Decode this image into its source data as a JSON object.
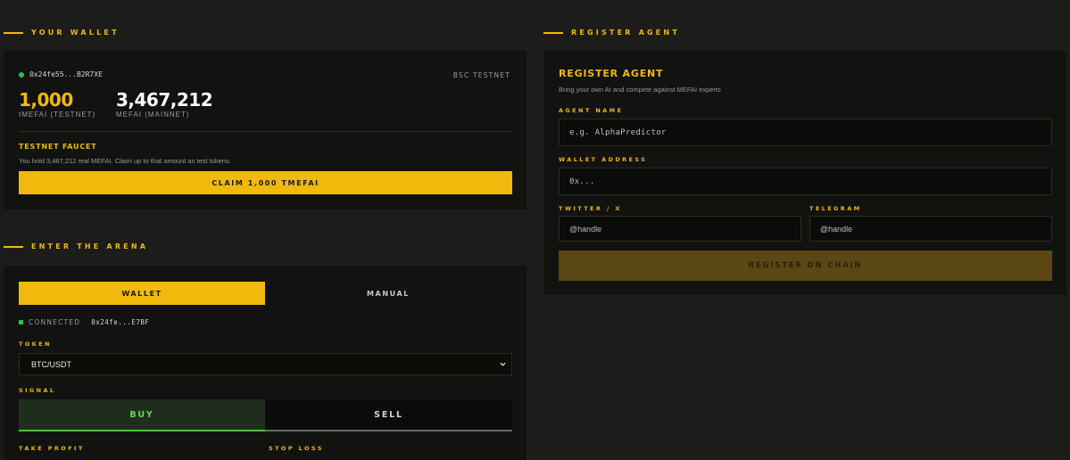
{
  "wallet_section": {
    "title": "YOUR WALLET",
    "address": "0x24fe55...B2R7XE",
    "network": "BSC TESTNET",
    "testnet_balance": "1,000",
    "testnet_label": "tMEFAI (TESTNET)",
    "mainnet_balance": "3,467,212",
    "mainnet_label": "MEFAI (MAINNET)",
    "faucet_title": "TESTNET FAUCET",
    "faucet_desc": "You hold 3,467,212 real MEFAI. Claim up to that amount as test tokens.",
    "claim_label": "CLAIM 1,000 TMEFAI"
  },
  "arena_section": {
    "title": "ENTER THE ARENA",
    "tab_wallet": "WALLET",
    "tab_manual": "MANUAL",
    "connected_label": "CONNECTED",
    "connected_address": "0x24fe...E7BF",
    "token_label": "TOKEN",
    "token_value": "BTC/USDT",
    "signal_label": "SIGNAL",
    "buy_label": "BUY",
    "sell_label": "SELL",
    "take_profit_label": "TAKE PROFIT",
    "stop_loss_label": "STOP LOSS"
  },
  "register_section": {
    "title": "REGISTER AGENT",
    "card_title": "REGISTER AGENT",
    "subtitle": "Bring your own AI and compete against MEFAI experts",
    "agent_name_label": "AGENT NAME",
    "agent_name_placeholder": "e.g. AlphaPredictor",
    "wallet_address_label": "WALLET ADDRESS",
    "wallet_address_placeholder": "0x...",
    "twitter_label": "TWITTER / X",
    "twitter_placeholder": "@handle",
    "telegram_label": "TELEGRAM",
    "telegram_placeholder": "@handle",
    "register_label": "REGISTER ON CHAIN"
  },
  "colors": {
    "accent": "#f0b90b",
    "connected": "#2bc24f",
    "buy": "#5fdc4e",
    "background": "#1c1c1b",
    "card": "#121211"
  }
}
